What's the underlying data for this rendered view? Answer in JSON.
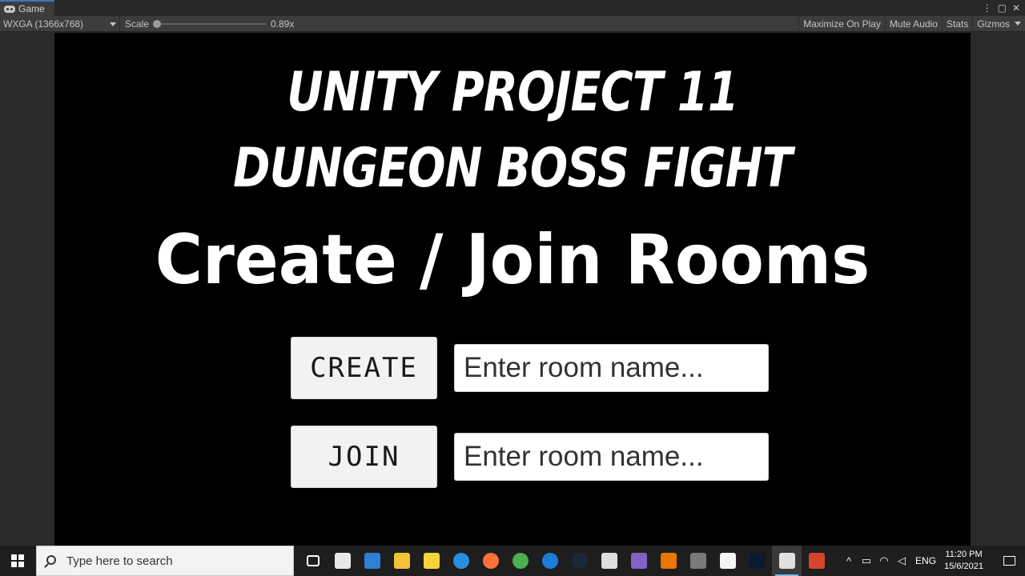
{
  "window": {
    "tab_label": "Game",
    "tab_icons": [
      "more-options-icon",
      "maximize-icon",
      "close-icon"
    ],
    "tab_icon_glyphs": [
      "⋮",
      "▢",
      "✕"
    ]
  },
  "toolbar": {
    "resolution": "WXGA (1366x768)",
    "scale_label": "Scale",
    "scale_value": "0.89x",
    "maximize_on_play": "Maximize On Play",
    "mute_audio": "Mute Audio",
    "stats": "Stats",
    "gizmos": "Gizmos"
  },
  "game": {
    "title_line1": "UNITY PROJECT 11",
    "title_line2": "DUNGEON BOSS FIGHT",
    "heading": "Create / Join Rooms",
    "create_label": "CREATE",
    "join_label": "JOIN",
    "create_room_placeholder": "Enter room name...",
    "join_room_placeholder": "Enter room name..."
  },
  "taskbar": {
    "search_placeholder": "Type here to search",
    "apps": [
      {
        "name": "task-view-icon",
        "color": "#1e1e1e"
      },
      {
        "name": "7zip-icon",
        "color": "#e8e8e8"
      },
      {
        "name": "photos-icon",
        "color": "#2f7fd6"
      },
      {
        "name": "file-explorer-icon",
        "color": "#f3c237"
      },
      {
        "name": "media-player-icon",
        "color": "#f7d33b"
      },
      {
        "name": "edge-icon",
        "color": "#2a8ee0"
      },
      {
        "name": "firefox-icon",
        "color": "#ff7139"
      },
      {
        "name": "chrome-icon",
        "color": "#4caf50"
      },
      {
        "name": "cortana-icon",
        "color": "#1f7bd8"
      },
      {
        "name": "steam-icon",
        "color": "#1b2838"
      },
      {
        "name": "unity-hub-icon",
        "color": "#dedede"
      },
      {
        "name": "visual-studio-icon",
        "color": "#8661c5"
      },
      {
        "name": "blender-icon",
        "color": "#ea7600"
      },
      {
        "name": "game-controller-icon",
        "color": "#7a7a7a"
      },
      {
        "name": "notepad-icon",
        "color": "#f5f5f5"
      },
      {
        "name": "terminal-icon",
        "color": "#0c1a2e"
      },
      {
        "name": "unity-icon",
        "color": "#e0e0e0"
      },
      {
        "name": "git-icon",
        "color": "#d4462a"
      }
    ],
    "active_app_index": 16,
    "language": "ENG",
    "time": "11:20 PM",
    "date": "15/6/2021"
  }
}
